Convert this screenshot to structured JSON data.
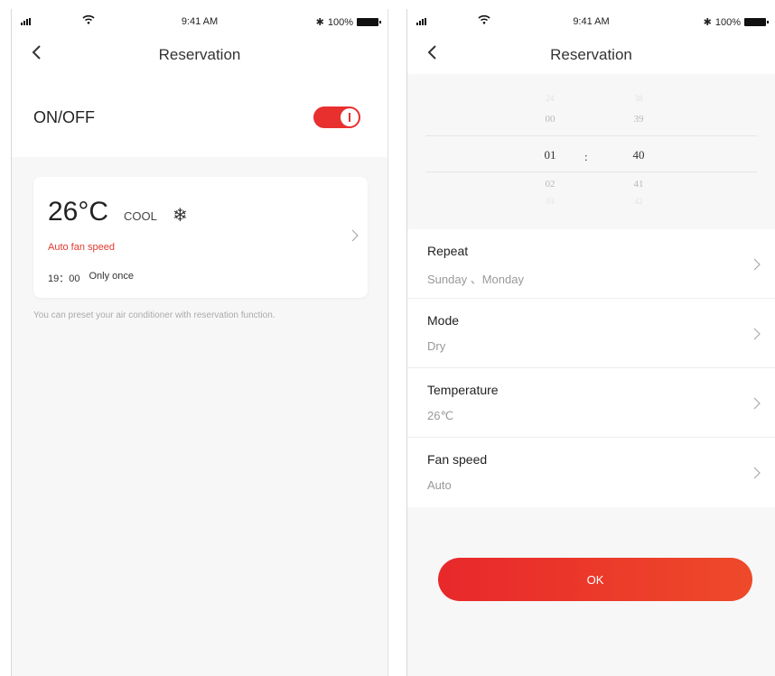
{
  "screen1": {
    "status": {
      "time": "9:41 AM",
      "battery": "100%"
    },
    "nav": {
      "title": "Reservation"
    },
    "power": {
      "label": "ON/OFF",
      "state": "on"
    },
    "card": {
      "temperature": "26°C",
      "mode": "COOL",
      "mode_icon": "snowflake-icon",
      "fan": "Auto fan speed",
      "time": "19：00",
      "repeat": "Only once"
    },
    "hint": "You can preset your air conditioner with reservation function."
  },
  "screen2": {
    "status": {
      "time": "9:41 AM",
      "battery": "100%"
    },
    "nav": {
      "title": "Reservation"
    },
    "picker": {
      "hours": [
        "24",
        "00",
        "01",
        "02",
        "03"
      ],
      "minutes": [
        "38",
        "39",
        "40",
        "41",
        "42"
      ],
      "separator": ":",
      "selected_hour": "01",
      "selected_minute": "40"
    },
    "settings": [
      {
        "label": "Repeat",
        "value": "Sunday 、Monday"
      },
      {
        "label": "Mode",
        "value": "Dry"
      },
      {
        "label": "Temperature",
        "value": "26℃"
      },
      {
        "label": "Fan speed",
        "value": "Auto"
      }
    ],
    "ok_label": "OK"
  },
  "colors": {
    "accent": "#e8302f",
    "hint": "#aaaaaa",
    "secondary_text": "#999999"
  }
}
